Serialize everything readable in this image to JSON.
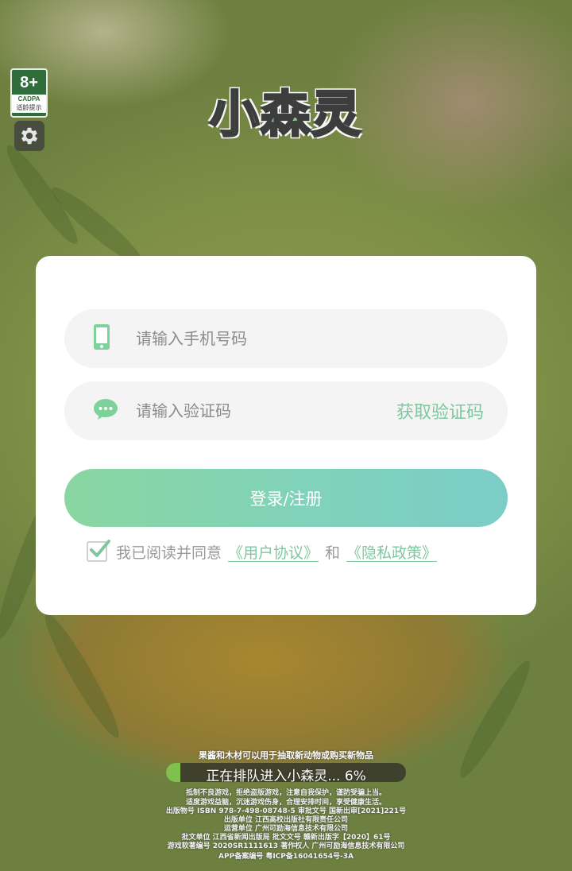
{
  "age_badge": {
    "age": "8+",
    "org": "CADPA",
    "tip": "适龄提示"
  },
  "logo": {
    "text": "小森灵"
  },
  "login": {
    "phone_placeholder": "请输入手机号码",
    "code_placeholder": "请输入验证码",
    "get_code_label": "获取验证码",
    "submit_label": "登录/注册",
    "agree_text": "我已阅读并同意",
    "user_agreement": "《用户协议》",
    "and_text": "和",
    "privacy_policy": "《隐私政策》",
    "agree_checked": true
  },
  "loading": {
    "tip": "果酱和木材可以用于抽取新动物或购买新物品",
    "status": "正在排队进入小森灵... 6%",
    "progress": 0.06
  },
  "legal": {
    "line1": "抵制不良游戏，拒绝盗版游戏，注意自我保护，谨防受骗上当。",
    "line2": "适度游戏益脑，沉迷游戏伤身，合理安排时间，享受健康生活。",
    "line3": "出版物号 ISBN 978-7-498-08748-5 审批文号 国新出审[2021]221号",
    "line4": "出版单位 江西高校出版社有限责任公司",
    "line5": "运营单位 广州可励海信息技术有限公司",
    "line6": "批文单位 江西省新闻出版局 批文文号 赣新出版字【2020】61号",
    "line7": "游戏软著编号 2020SR1111613 著作权人 广州可励海信息技术有限公司",
    "line8": "APP备案编号 粤ICP备16041654号-3A"
  },
  "colors": {
    "accent": "#7fc79f",
    "button_start": "#8ad6a1",
    "button_end": "#7ccdc7",
    "progress_fill": "#7fc04e"
  },
  "icons": {
    "phone": "phone-icon",
    "message": "message-icon",
    "settings": "gear-icon",
    "check": "checkmark-icon"
  }
}
